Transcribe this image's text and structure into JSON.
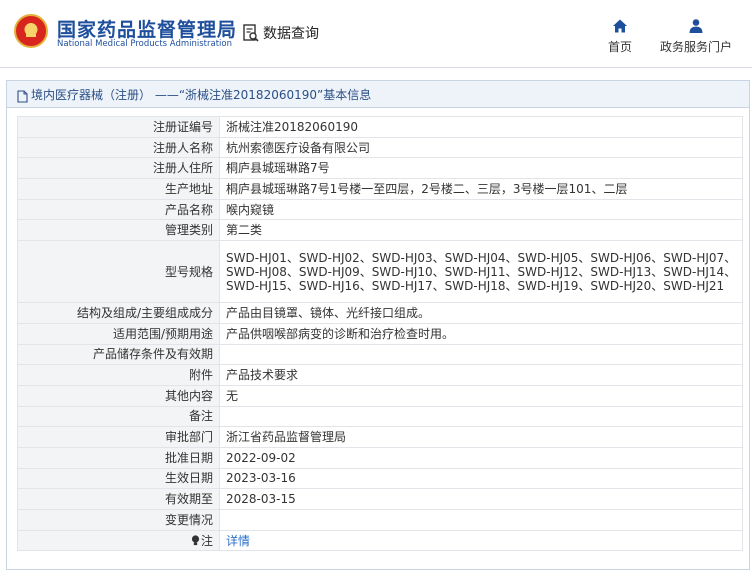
{
  "header": {
    "site_title": "国家药品监督管理局",
    "site_subtitle": "National Medical Products Administration",
    "query_label": "数据查询",
    "nav": [
      {
        "label": "首页",
        "icon": "home-icon"
      },
      {
        "label": "政务服务门户",
        "icon": "user-icon"
      }
    ]
  },
  "panel": {
    "title": "境内医疗器械（注册） ——“浙械注准20182060190”基本信息"
  },
  "rows": [
    {
      "label": "注册证编号",
      "value": "浙械注准20182060190"
    },
    {
      "label": "注册人名称",
      "value": "杭州索德医疗设备有限公司"
    },
    {
      "label": "注册人住所",
      "value": "桐庐县城瑶琳路7号"
    },
    {
      "label": "生产地址",
      "value": "桐庐县城瑶琳路7号1号楼一至四层，2号楼二、三层，3号楼一层101、二层"
    },
    {
      "label": "产品名称",
      "value": "喉内窥镜"
    },
    {
      "label": "管理类别",
      "value": "第二类"
    },
    {
      "label": "型号规格",
      "value": "SWD-HJ01、SWD-HJ02、SWD-HJ03、SWD-HJ04、SWD-HJ05、SWD-HJ06、SWD-HJ07、SWD-HJ08、SWD-HJ09、SWD-HJ10、SWD-HJ11、SWD-HJ12、SWD-HJ13、SWD-HJ14、SWD-HJ15、SWD-HJ16、SWD-HJ17、SWD-HJ18、SWD-HJ19、SWD-HJ20、SWD-HJ21"
    },
    {
      "label": "结构及组成/主要组成成分",
      "value": "产品由目镜罩、镜体、光纤接口组成。"
    },
    {
      "label": "适用范围/预期用途",
      "value": "产品供咽喉部病变的诊断和治疗检查时用。"
    },
    {
      "label": "产品储存条件及有效期",
      "value": ""
    },
    {
      "label": "附件",
      "value": "产品技术要求"
    },
    {
      "label": "其他内容",
      "value": "无"
    },
    {
      "label": "备注",
      "value": ""
    },
    {
      "label": "审批部门",
      "value": "浙江省药品监督管理局"
    },
    {
      "label": "批准日期",
      "value": "2022-09-02"
    },
    {
      "label": "生效日期",
      "value": "2023-03-16"
    },
    {
      "label": "有效期至",
      "value": "2028-03-15"
    },
    {
      "label": "变更情况",
      "value": ""
    },
    {
      "label": "注",
      "value": "详情"
    }
  ],
  "colors": {
    "brand_blue": "#1e4f9c",
    "link_blue": "#2a6fc9",
    "label_bg": "#f3f4f6",
    "panel_head_bg": "#eef3fa"
  }
}
